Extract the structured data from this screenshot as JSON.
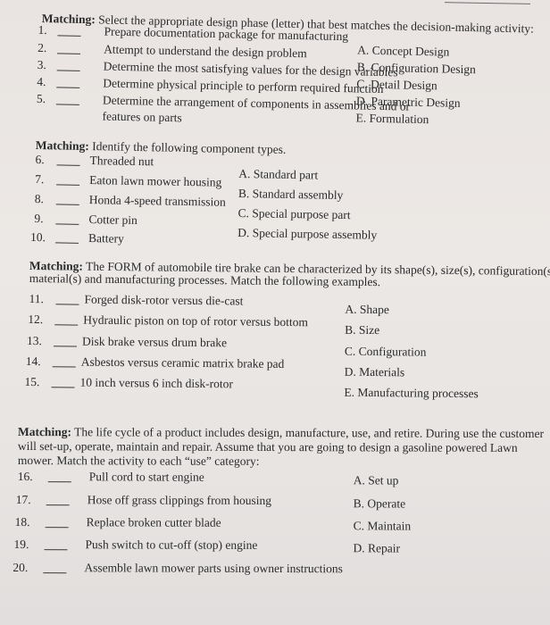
{
  "sections": [
    {
      "label": "Matching:",
      "intro": "Select the appropriate design phase (letter) that best matches the decision-making activity:",
      "questions": [
        {
          "num": "1.",
          "blank": "_____",
          "text": "Prepare documentation package for manufacturing"
        },
        {
          "num": "2.",
          "blank": "_____",
          "text": "Attempt to understand the design problem"
        },
        {
          "num": "3.",
          "blank": "_____",
          "text": "Determine the most satisfying values for the design variables"
        },
        {
          "num": "4.",
          "blank": "_____",
          "text": "Determine physical principle to perform required function"
        },
        {
          "num": "5.",
          "blank": "_____",
          "text": "Determine the arrangement of components in assemblies and or"
        }
      ],
      "q5_continuation": "features on parts",
      "options": [
        "A. Concept Design",
        "B. Configuration Design",
        "C. Detail Design",
        "D. Parametric Design",
        "E. Formulation"
      ]
    },
    {
      "label": "Matching:",
      "intro": "Identify the following component types.",
      "questions": [
        {
          "num": "6.",
          "blank": "_____",
          "text": "Threaded nut"
        },
        {
          "num": "7.",
          "blank": "_____",
          "text": "Eaton lawn mower housing"
        },
        {
          "num": "8.",
          "blank": "_____",
          "text": "Honda 4-speed transmission"
        },
        {
          "num": "9.",
          "blank": "_____",
          "text": "Cotter pin"
        },
        {
          "num": "10.",
          "blank": "_____",
          "text": "Battery"
        }
      ],
      "options": [
        "A. Standard part",
        "B. Standard assembly",
        "C. Special purpose part",
        "D. Special purpose assembly"
      ]
    },
    {
      "label": "Matching:",
      "intro": "The FORM of automobile tire brake can be characterized by its shape(s), size(s), configuration(s)",
      "intro_line2": "material(s) and manufacturing processes. Match the following examples.",
      "questions": [
        {
          "num": "11.",
          "blank": "_____",
          "text": "Forged disk-rotor versus die-cast"
        },
        {
          "num": "12.",
          "blank": "_____",
          "text": "Hydraulic piston on top of rotor versus bottom"
        },
        {
          "num": "13.",
          "blank": "_____",
          "text": "Disk brake versus drum brake"
        },
        {
          "num": "14.",
          "blank": "_____",
          "text": "Asbestos versus ceramic matrix brake pad"
        },
        {
          "num": "15.",
          "blank": "_____",
          "text": "10 inch versus 6 inch disk-rotor"
        }
      ],
      "options": [
        "A.  Shape",
        "B.  Size",
        "C.  Configuration",
        "D.  Materials",
        "E.  Manufacturing processes"
      ]
    },
    {
      "label": "Matching:",
      "intro": "The life cycle of a product includes design, manufacture, use, and retire. During use the customer",
      "intro_line2": "will set-up, operate, maintain and repair. Assume that you are going to design a gasoline powered Lawn",
      "intro_line3": "mower.  Match the activity to each “use” category:",
      "questions": [
        {
          "num": "16.",
          "blank": "_____",
          "text": "Pull cord to start engine"
        },
        {
          "num": "17.",
          "blank": "_____",
          "text": "Hose off grass clippings from housing"
        },
        {
          "num": "18.",
          "blank": "_____",
          "text": "Replace broken cutter blade"
        },
        {
          "num": "19.",
          "blank": "_____",
          "text": "Push switch to cut-off (stop) engine"
        },
        {
          "num": "20.",
          "blank": "_____",
          "text": "Assemble lawn mower parts using owner instructions"
        }
      ],
      "options": [
        "A.  Set up",
        "B.  Operate",
        "C.  Maintain",
        "D.  Repair"
      ]
    }
  ]
}
